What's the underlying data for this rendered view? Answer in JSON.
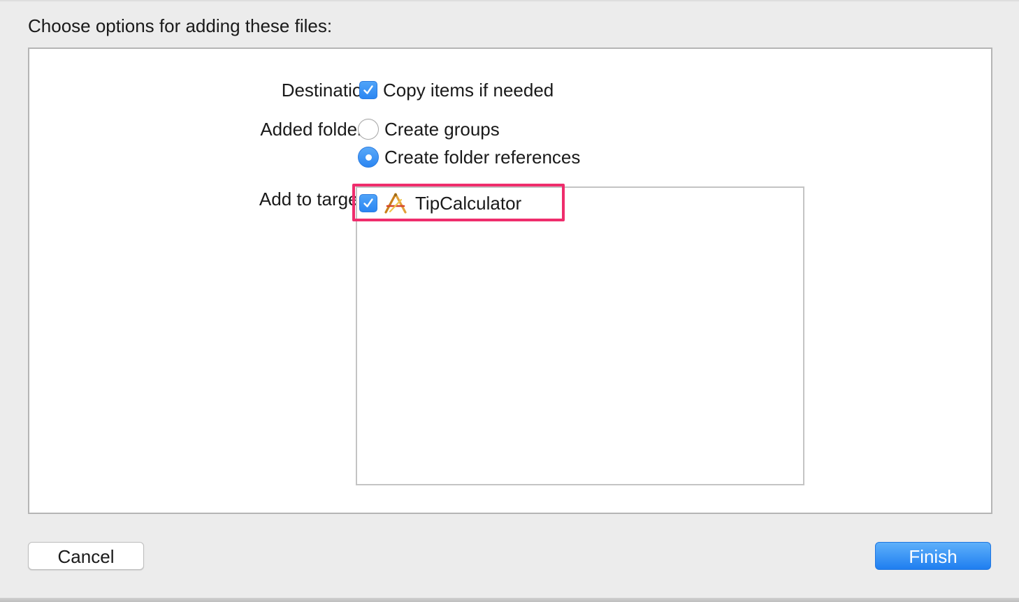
{
  "dialog": {
    "header": "Choose options for adding these files:"
  },
  "destination": {
    "label": "Destination:",
    "checkbox_label": "Copy items if needed",
    "checked": true
  },
  "added_folders": {
    "label": "Added folders:",
    "options": [
      {
        "label": "Create groups",
        "selected": false
      },
      {
        "label": "Create folder references",
        "selected": true
      }
    ]
  },
  "targets": {
    "label": "Add to targets:",
    "items": [
      {
        "name": "TipCalculator",
        "checked": true,
        "icon": "xcode-app-icon"
      }
    ]
  },
  "buttons": {
    "cancel": "Cancel",
    "finish": "Finish"
  },
  "colors": {
    "accent": "#2b86f2",
    "highlight": "#ef2d6c",
    "background": "#ececec"
  }
}
